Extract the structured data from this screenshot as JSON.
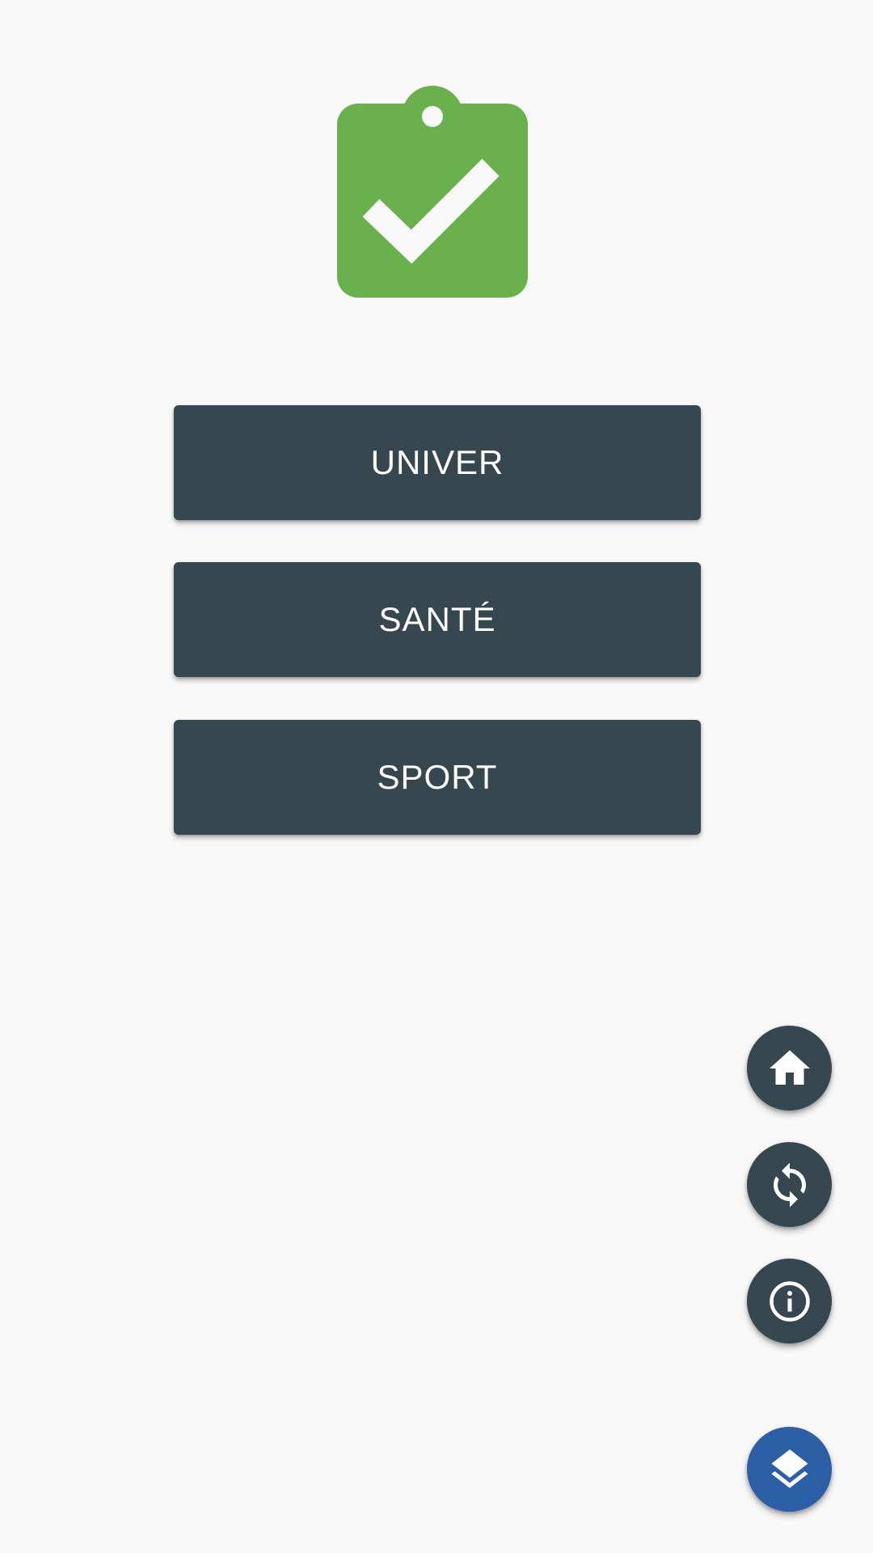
{
  "app": {
    "logo_icon": "clipboard-check-icon",
    "logo_color": "#6ab04c"
  },
  "menu": {
    "items": [
      {
        "label": "UNIVER"
      },
      {
        "label": "SANTÉ"
      },
      {
        "label": "SPORT"
      }
    ],
    "button_color": "#37474f"
  },
  "fabs": {
    "home_icon": "home-icon",
    "refresh_icon": "refresh-icon",
    "info_icon": "info-icon",
    "layers_icon": "layers-icon",
    "dark_color": "#37474f",
    "accent_color": "#2d5fa6"
  }
}
